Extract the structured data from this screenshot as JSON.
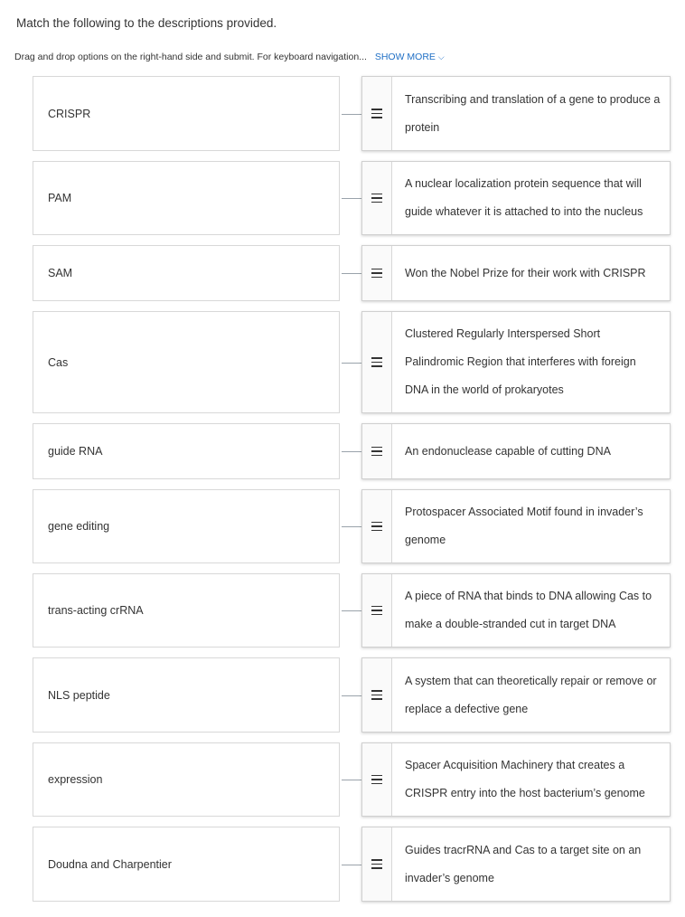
{
  "question": {
    "title": "Match the following to the descriptions provided.",
    "instructions": "Drag and drop options on the right-hand side and submit. For keyboard navigation...",
    "show_more_label": "SHOW MORE"
  },
  "pairs": [
    {
      "term": "CRISPR",
      "description": "Transcribing and translation of a gene to produce a protein"
    },
    {
      "term": "PAM",
      "description": "A nuclear localization protein sequence that will guide whatever it is attached to into the nucleus"
    },
    {
      "term": "SAM",
      "description": "Won the Nobel Prize for their work with CRISPR"
    },
    {
      "term": "Cas",
      "description": "Clustered Regularly Interspersed Short Palindromic Region that interferes with foreign DNA in the world of prokaryotes"
    },
    {
      "term": "guide RNA",
      "description": "An endonuclease capable of cutting DNA"
    },
    {
      "term": "gene editing",
      "description": "Protospacer Associated Motif found in invader’s genome"
    },
    {
      "term": "trans-acting crRNA",
      "description": "A piece of RNA that binds to DNA allowing Cas to make a double-stranded cut in target DNA"
    },
    {
      "term": "NLS peptide",
      "description": "A system that can theoretically repair or remove or replace a defective gene"
    },
    {
      "term": "expression",
      "description": "Spacer Acquisition Machinery that creates a CRISPR entry into the host bacterium’s genome"
    },
    {
      "term": "Doudna and Charpentier",
      "description": "Guides tracrRNA and Cas to a target site on an invader’s genome"
    }
  ]
}
